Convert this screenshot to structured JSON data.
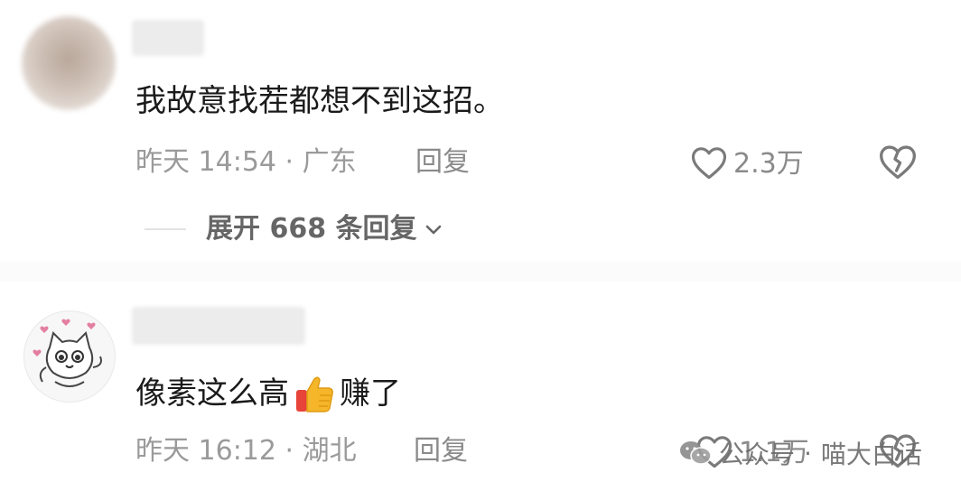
{
  "comments": [
    {
      "text": "我故意找茬都想不到这招。",
      "time_location": "昨天 14:54 · 广东",
      "reply_label": "回复",
      "like_count": "2.3万",
      "expand_replies": "展开 668 条回复"
    },
    {
      "text_before": "像素这么高",
      "text_after": "赚了",
      "emoji_icon": "thumbs-up-icon",
      "time_location": "昨天 16:12 · 湖北",
      "reply_label": "回复",
      "like_count": "1.1万"
    }
  ],
  "watermark": {
    "prefix": "公众号",
    "separator": "·",
    "account": "喵大白话",
    "icon": "wechat-icon"
  },
  "colors": {
    "text_primary": "#1a1a1a",
    "text_meta": "#9a9a9a",
    "thumb_yellow": "#f5b62a",
    "thumb_red": "#e8443a"
  }
}
